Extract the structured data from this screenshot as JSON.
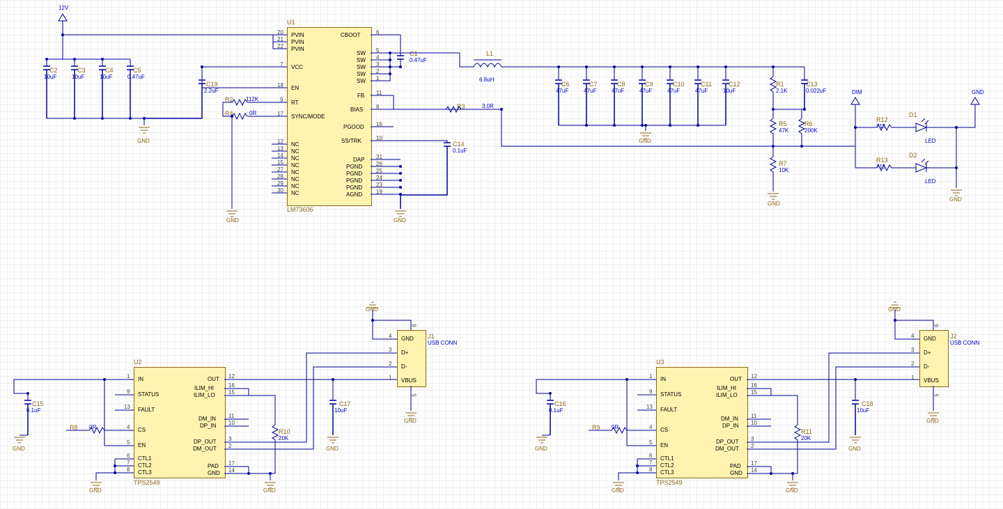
{
  "supply": {
    "v12": "12V",
    "gnd": "GND",
    "dim": "DIM"
  },
  "u1": {
    "ref": "U1",
    "part": "LM73606",
    "pins": {
      "PVIN1": "PVIN",
      "PVIN2": "PVIN",
      "PVIN3": "PVIN",
      "VCC": "VCC",
      "EN": "EN",
      "RT": "RT",
      "SYNC": "SYNC/MODE",
      "NC1": "NC",
      "NC2": "NC",
      "NC3": "NC",
      "NC4": "NC",
      "NC5": "NC",
      "NC6": "NC",
      "NC7": "NC",
      "NC8": "NC",
      "CBOOT": "CBOOT",
      "SW1": "SW",
      "SW2": "SW",
      "SW3": "SW",
      "SW4": "SW",
      "SW5": "SW",
      "FB": "FB",
      "BIAS": "BIAS",
      "PGOOD": "PGOOD",
      "SSTRK": "SS/TRK",
      "DAP": "DAP",
      "PGND1": "PGND",
      "PGND2": "PGND",
      "PGND3": "PGND",
      "PGND4": "PGND",
      "AGND": "AGND"
    },
    "nums": {
      "PVIN1": "20",
      "PVIN2": "21",
      "PVIN3": "22",
      "VCC": "7",
      "EN": "18",
      "RT": "9",
      "SYNC": "17",
      "NC1": "12",
      "NC2": "13",
      "NC3": "14",
      "NC4": "15",
      "NC5": "27",
      "NC6": "28",
      "NC7": "29",
      "NC8": "30",
      "CBOOT": "6",
      "SW1": "5",
      "SW2": "4",
      "SW3": "3",
      "SW4": "2",
      "SW5": "1",
      "FB": "11",
      "BIAS": "8",
      "PGOOD": "16",
      "SSTRK": "10",
      "DAP": "31",
      "PGND1": "26",
      "PGND2": "25",
      "PGND3": "24",
      "PGND4": "23",
      "AGND": "19"
    }
  },
  "caps": {
    "C1": {
      "ref": "C1",
      "val": "0.47uF"
    },
    "C2": {
      "ref": "C2",
      "val": "10uF"
    },
    "C3": {
      "ref": "C3",
      "val": "10uF"
    },
    "C4": {
      "ref": "C4",
      "val": "10uF"
    },
    "C5": {
      "ref": "C5",
      "val": "0.47uF"
    },
    "C6": {
      "ref": "C6",
      "val": "47uF"
    },
    "C7": {
      "ref": "C7",
      "val": "47uF"
    },
    "C8": {
      "ref": "C8",
      "val": "47uF"
    },
    "C9": {
      "ref": "C9",
      "val": "47uF"
    },
    "C10": {
      "ref": "C10",
      "val": "47uF"
    },
    "C11": {
      "ref": "C11",
      "val": "47uF"
    },
    "C12": {
      "ref": "C12",
      "val": "10uF"
    },
    "C13": {
      "ref": "C13",
      "val": "0.022uF"
    },
    "C14": {
      "ref": "C14",
      "val": "0.1uF"
    },
    "C19": {
      "ref": "C19",
      "val": "2.2uF"
    },
    "C15": {
      "ref": "C15",
      "val": "0.1uF"
    },
    "C16": {
      "ref": "C16",
      "val": "0.1uF"
    },
    "C17": {
      "ref": "C17",
      "val": "10uF"
    },
    "C18": {
      "ref": "C18",
      "val": "10uF"
    }
  },
  "res": {
    "R1": {
      "ref": "R1",
      "val": "2.1K"
    },
    "R2": {
      "ref": "R2",
      "val": "112K"
    },
    "R3": {
      "ref": "R3",
      "val": "3.0R"
    },
    "R4": {
      "ref": "R4",
      "val": "0R"
    },
    "R5": {
      "ref": "R5",
      "val": "47K"
    },
    "R6": {
      "ref": "R6",
      "val": "200K"
    },
    "R7": {
      "ref": "R7",
      "val": "10K"
    },
    "R8": {
      "ref": "R8",
      "val": "0R"
    },
    "R9": {
      "ref": "R9",
      "val": "0R"
    },
    "R10": {
      "ref": "R10",
      "val": "20K"
    },
    "R11": {
      "ref": "R11",
      "val": "20K"
    },
    "R12": {
      "ref": "R12",
      "val": "715"
    },
    "R13": {
      "ref": "R13",
      "val": "715"
    }
  },
  "ind": {
    "L1": {
      "ref": "L1",
      "val": "6.8uH"
    }
  },
  "leds": {
    "D1": {
      "ref": "D1",
      "val": "LED"
    },
    "D2": {
      "ref": "D2",
      "val": "LED"
    }
  },
  "u2": {
    "ref": "U2",
    "part": "TPS2549",
    "left": {
      "IN": "IN",
      "STATUS": "STATUS",
      "FAULT": "FAULT",
      "CS": "CS",
      "EN": "EN",
      "CTL1": "CTL1",
      "CTL2": "CTL2",
      "CTL3": "CTL3"
    },
    "leftn": {
      "IN": "1",
      "STATUS": "9",
      "FAULT": "13",
      "CS": "4",
      "EN": "5",
      "CTL1": "6",
      "CTL2": "7",
      "CTL3": "8"
    },
    "right": {
      "OUT": "OUT",
      "ILIM_HI": "ILIM_HI",
      "ILIM_LO": "ILIM_LO",
      "DM_IN": "DM_IN",
      "DP_IN": "DP_IN",
      "DP_OUT": "DP_OUT",
      "DM_OUT": "DM_OUT",
      "PAD": "PAD",
      "GND": "GND"
    },
    "rightn": {
      "OUT": "12",
      "ILIM_HI": "16",
      "ILIM_LO": "15",
      "DM_IN": "11",
      "DP_IN": "10",
      "DP_OUT": "3",
      "DM_OUT": "2",
      "PAD": "17",
      "GND": "14"
    }
  },
  "u3": {
    "ref": "U3",
    "part": "TPS2549"
  },
  "usb": {
    "ref1": "J1",
    "ref2": "J2",
    "conn": "USB CONN",
    "pins": {
      "GND": "GND",
      "DP": "D+",
      "DM": "D-",
      "VBUS": "VBUS"
    },
    "nums": {
      "SHLD": "6",
      "GND": "4",
      "DP": "3",
      "DM": "2",
      "VBUS": "1",
      "SHLD2": "5"
    }
  }
}
